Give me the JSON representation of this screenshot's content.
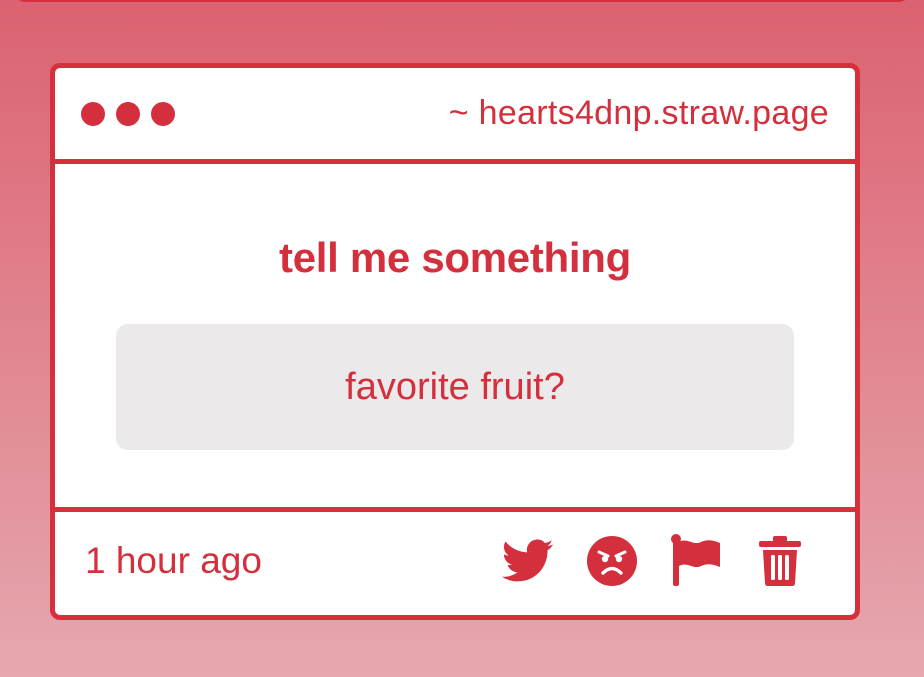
{
  "window": {
    "url": "~ hearts4dnp.straw.page"
  },
  "card": {
    "prompt": "tell me something",
    "question": "favorite fruit?",
    "timestamp": "1 hour ago"
  },
  "icons": [
    "twitter-icon",
    "angry-face-icon",
    "flag-icon",
    "trash-icon"
  ],
  "colors": {
    "accent": "#d32f3c",
    "question_bg": "#ebe9ea",
    "background_top": "#db6270",
    "background_bottom": "#e6a7af"
  }
}
